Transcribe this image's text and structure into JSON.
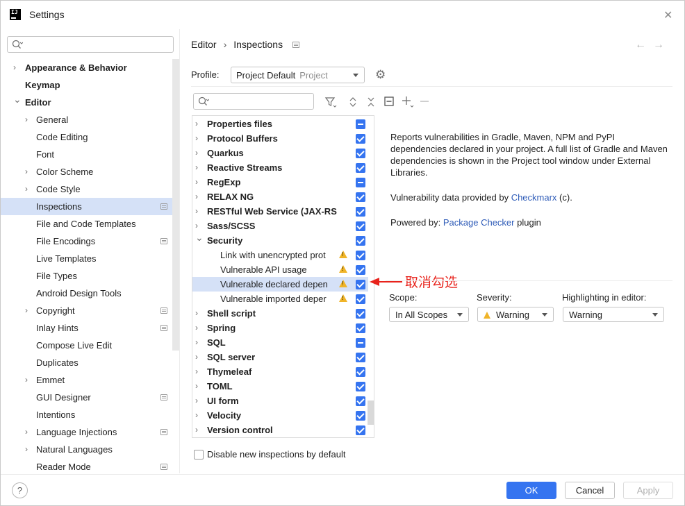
{
  "window": {
    "title": "Settings",
    "app_icon_text": "IJ"
  },
  "sidebar": {
    "items": [
      {
        "label": "Appearance & Behavior",
        "level": 0,
        "chevron": "right",
        "bold": true
      },
      {
        "label": "Keymap",
        "level": 0,
        "chevron": "",
        "bold": true
      },
      {
        "label": "Editor",
        "level": 0,
        "chevron": "down",
        "bold": true
      },
      {
        "label": "General",
        "level": 1,
        "chevron": "right"
      },
      {
        "label": "Code Editing",
        "level": 1,
        "chevron": ""
      },
      {
        "label": "Font",
        "level": 1,
        "chevron": ""
      },
      {
        "label": "Color Scheme",
        "level": 1,
        "chevron": "right"
      },
      {
        "label": "Code Style",
        "level": 1,
        "chevron": "right"
      },
      {
        "label": "Inspections",
        "level": 1,
        "chevron": "",
        "selected": true,
        "project_icon": true
      },
      {
        "label": "File and Code Templates",
        "level": 1,
        "chevron": ""
      },
      {
        "label": "File Encodings",
        "level": 1,
        "chevron": "",
        "project_icon": true
      },
      {
        "label": "Live Templates",
        "level": 1,
        "chevron": ""
      },
      {
        "label": "File Types",
        "level": 1,
        "chevron": ""
      },
      {
        "label": "Android Design Tools",
        "level": 1,
        "chevron": ""
      },
      {
        "label": "Copyright",
        "level": 1,
        "chevron": "right",
        "project_icon": true
      },
      {
        "label": "Inlay Hints",
        "level": 1,
        "chevron": "",
        "project_icon": true
      },
      {
        "label": "Compose Live Edit",
        "level": 1,
        "chevron": ""
      },
      {
        "label": "Duplicates",
        "level": 1,
        "chevron": ""
      },
      {
        "label": "Emmet",
        "level": 1,
        "chevron": "right"
      },
      {
        "label": "GUI Designer",
        "level": 1,
        "chevron": "",
        "project_icon": true
      },
      {
        "label": "Intentions",
        "level": 1,
        "chevron": ""
      },
      {
        "label": "Language Injections",
        "level": 1,
        "chevron": "right",
        "project_icon": true
      },
      {
        "label": "Natural Languages",
        "level": 1,
        "chevron": "right"
      },
      {
        "label": "Reader Mode",
        "level": 1,
        "chevron": "",
        "project_icon": true
      }
    ]
  },
  "breadcrumb": {
    "parent": "Editor",
    "current": "Inspections"
  },
  "profile": {
    "label": "Profile:",
    "value": "Project Default",
    "scope": "Project"
  },
  "inspections": [
    {
      "label": "Properties files",
      "type": "cat",
      "chevron": "right",
      "check": "partial"
    },
    {
      "label": "Protocol Buffers",
      "type": "cat",
      "chevron": "right",
      "check": "on"
    },
    {
      "label": "Quarkus",
      "type": "cat",
      "chevron": "right",
      "check": "on"
    },
    {
      "label": "Reactive Streams",
      "type": "cat",
      "chevron": "right",
      "check": "on"
    },
    {
      "label": "RegExp",
      "type": "cat",
      "chevron": "right",
      "check": "partial"
    },
    {
      "label": "RELAX NG",
      "type": "cat",
      "chevron": "right",
      "check": "on"
    },
    {
      "label": "RESTful Web Service (JAX-RS",
      "type": "cat",
      "chevron": "right",
      "check": "on"
    },
    {
      "label": "Sass/SCSS",
      "type": "cat",
      "chevron": "right",
      "check": "on"
    },
    {
      "label": "Security",
      "type": "cat",
      "chevron": "down",
      "check": "on"
    },
    {
      "label": "Link with unencrypted prot",
      "type": "leaf",
      "warn": true,
      "check": "on"
    },
    {
      "label": "Vulnerable API usage",
      "type": "leaf",
      "warn": true,
      "check": "on"
    },
    {
      "label": "Vulnerable declared depen",
      "type": "leaf",
      "warn": true,
      "check": "on",
      "selected": true
    },
    {
      "label": "Vulnerable imported deper",
      "type": "leaf",
      "warn": true,
      "check": "on"
    },
    {
      "label": "Shell script",
      "type": "cat",
      "chevron": "right",
      "check": "on"
    },
    {
      "label": "Spring",
      "type": "cat",
      "chevron": "right",
      "check": "on"
    },
    {
      "label": "SQL",
      "type": "cat",
      "chevron": "right",
      "check": "partial"
    },
    {
      "label": "SQL server",
      "type": "cat",
      "chevron": "right",
      "check": "on"
    },
    {
      "label": "Thymeleaf",
      "type": "cat",
      "chevron": "right",
      "check": "on"
    },
    {
      "label": "TOML",
      "type": "cat",
      "chevron": "right",
      "check": "on"
    },
    {
      "label": "UI form",
      "type": "cat",
      "chevron": "right",
      "check": "on"
    },
    {
      "label": "Velocity",
      "type": "cat",
      "chevron": "right",
      "check": "on"
    },
    {
      "label": "Version control",
      "type": "cat",
      "chevron": "right",
      "check": "on"
    }
  ],
  "annotation": {
    "text": "取消勾选",
    "color": "#e8231c"
  },
  "description": {
    "p1": "Reports vulnerabilities in Gradle, Maven, NPM and PyPI dependencies declared in your project. A full list of Gradle and Maven dependencies is shown in the Project tool window under External Libraries.",
    "p2_prefix": "Vulnerability data provided by ",
    "p2_link": "Checkmarx",
    "p2_suffix": " (c).",
    "p3_prefix": "Powered by: ",
    "p3_link": "Package Checker",
    "p3_suffix": " plugin"
  },
  "options": {
    "scope_label": "Scope:",
    "scope_value": "In All Scopes",
    "severity_label": "Severity:",
    "severity_value": "Warning",
    "highlight_label": "Highlighting in editor:",
    "highlight_value": "Warning"
  },
  "footer": {
    "disable_label": "Disable new inspections by default",
    "help": "?",
    "ok": "OK",
    "cancel": "Cancel",
    "apply": "Apply"
  },
  "colors": {
    "accent": "#3574f0",
    "selection": "#d5e1f7",
    "warning": "#f0b428",
    "link": "#2f5cb8"
  }
}
